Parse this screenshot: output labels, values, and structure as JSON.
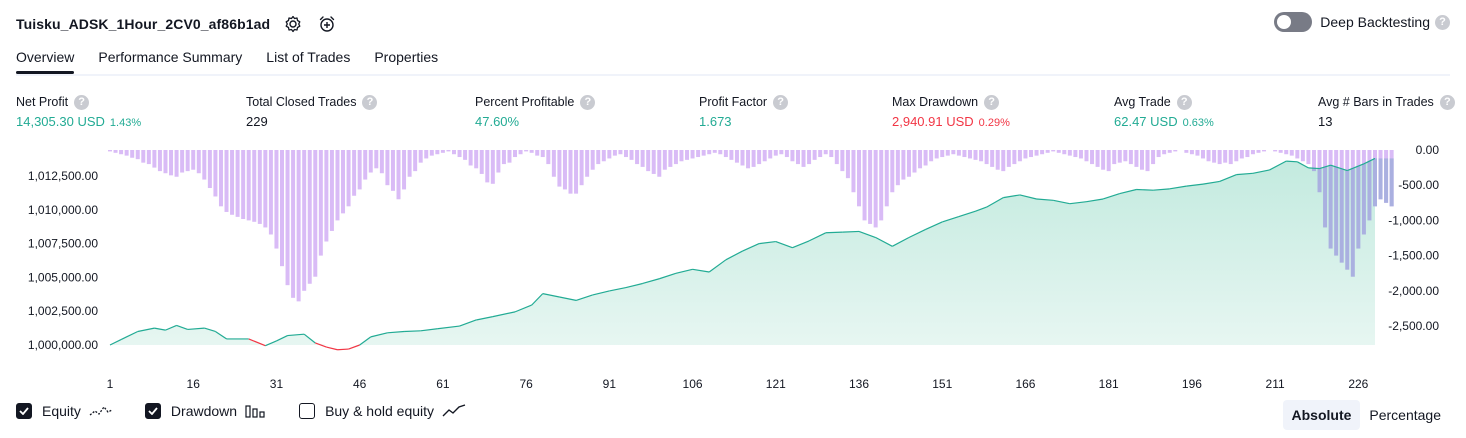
{
  "header": {
    "title": "Tuisku_ADSK_1Hour_2CV0_af86b1ad",
    "deep_backtesting": "Deep Backtesting",
    "help": "?"
  },
  "tabs": [
    "Overview",
    "Performance Summary",
    "List of Trades",
    "Properties"
  ],
  "metrics": [
    {
      "label": "Net Profit",
      "value": "14,305.30 USD",
      "pct": "1.43%",
      "color": "#22ab94"
    },
    {
      "label": "Total Closed Trades",
      "value": "229",
      "pct": "",
      "color": "#131722"
    },
    {
      "label": "Percent Profitable",
      "value": "47.60%",
      "pct": "",
      "color": "#22ab94"
    },
    {
      "label": "Profit Factor",
      "value": "1.673",
      "pct": "",
      "color": "#22ab94"
    },
    {
      "label": "Max Drawdown",
      "value": "2,940.91 USD",
      "pct": "0.29%",
      "color": "#f23645"
    },
    {
      "label": "Avg Trade",
      "value": "62.47 USD",
      "pct": "0.63%",
      "color": "#22ab94"
    },
    {
      "label": "Avg # Bars in Trades",
      "value": "13",
      "pct": "",
      "color": "#131722"
    }
  ],
  "legend": {
    "equity": "Equity",
    "drawdown": "Drawdown",
    "buyhold": "Buy & hold equity"
  },
  "modes": {
    "absolute": "Absolute",
    "percentage": "Percentage"
  },
  "colors": {
    "equity_line": "#22ab94",
    "equity_fill": "#cdeee5",
    "drawdown_bar": "#d9bbf6",
    "drawdown_overlap": "#aab0e0",
    "negative": "#f23645"
  },
  "chart_data": {
    "type": "area",
    "x": [
      1,
      229
    ],
    "xticks": [
      1,
      16,
      31,
      46,
      61,
      76,
      91,
      106,
      121,
      136,
      151,
      166,
      181,
      196,
      211,
      226
    ],
    "left_ticks": [
      "1,012,500.00",
      "1,010,000.00",
      "1,007,500.00",
      "1,005,000.00",
      "1,002,500.00",
      "1,000,000.00"
    ],
    "left_tick_values": [
      1012500,
      1010000,
      1007500,
      1005000,
      1002500,
      1000000
    ],
    "right_ticks": [
      "0.00",
      "-500.00",
      "-1,000.00",
      "-1,500.00",
      "-2,000.00",
      "-2,500.00"
    ],
    "right_tick_values": [
      0,
      -500,
      -1000,
      -1500,
      -2000,
      -2500
    ],
    "equity_ylim": [
      999000,
      1014000
    ],
    "drawdown_ylim": [
      -3000,
      0
    ],
    "series": [
      {
        "name": "Equity",
        "points": [
          [
            1,
            1000000
          ],
          [
            3,
            1000400
          ],
          [
            6,
            1001000
          ],
          [
            9,
            1001250
          ],
          [
            11,
            1001100
          ],
          [
            13,
            1001450
          ],
          [
            15,
            1001150
          ],
          [
            18,
            1001250
          ],
          [
            20,
            1001000
          ],
          [
            22,
            1000450
          ],
          [
            26,
            1000450
          ],
          [
            29,
            999950
          ],
          [
            31,
            1000300
          ],
          [
            33,
            1000700
          ],
          [
            36,
            1000800
          ],
          [
            38,
            1000150
          ],
          [
            40,
            999850
          ],
          [
            42,
            999650
          ],
          [
            44,
            999700
          ],
          [
            46,
            1000000
          ],
          [
            48,
            1000600
          ],
          [
            51,
            1000900
          ],
          [
            54,
            1001000
          ],
          [
            57,
            1001050
          ],
          [
            60,
            1001200
          ],
          [
            64,
            1001400
          ],
          [
            67,
            1001850
          ],
          [
            70,
            1002100
          ],
          [
            74,
            1002450
          ],
          [
            77,
            1002950
          ],
          [
            79,
            1003800
          ],
          [
            82,
            1003550
          ],
          [
            85,
            1003300
          ],
          [
            88,
            1003700
          ],
          [
            91,
            1004000
          ],
          [
            94,
            1004250
          ],
          [
            97,
            1004550
          ],
          [
            100,
            1004900
          ],
          [
            103,
            1005300
          ],
          [
            106,
            1005600
          ],
          [
            109,
            1005400
          ],
          [
            112,
            1006300
          ],
          [
            115,
            1006950
          ],
          [
            118,
            1007500
          ],
          [
            121,
            1007650
          ],
          [
            124,
            1007200
          ],
          [
            127,
            1007700
          ],
          [
            130,
            1008300
          ],
          [
            133,
            1008350
          ],
          [
            136,
            1008400
          ],
          [
            139,
            1007950
          ],
          [
            142,
            1007300
          ],
          [
            145,
            1007950
          ],
          [
            148,
            1008550
          ],
          [
            151,
            1009100
          ],
          [
            154,
            1009500
          ],
          [
            157,
            1009900
          ],
          [
            159,
            1010200
          ],
          [
            162,
            1010900
          ],
          [
            165,
            1011100
          ],
          [
            168,
            1010800
          ],
          [
            171,
            1010700
          ],
          [
            174,
            1010450
          ],
          [
            177,
            1010600
          ],
          [
            180,
            1010800
          ],
          [
            183,
            1011200
          ],
          [
            186,
            1011500
          ],
          [
            189,
            1011450
          ],
          [
            192,
            1011550
          ],
          [
            195,
            1011750
          ],
          [
            198,
            1011900
          ],
          [
            201,
            1012100
          ],
          [
            204,
            1012600
          ],
          [
            207,
            1012700
          ],
          [
            210,
            1012950
          ],
          [
            213,
            1013600
          ],
          [
            215,
            1013550
          ],
          [
            217,
            1013100
          ],
          [
            219,
            1013050
          ],
          [
            221,
            1013300
          ],
          [
            224,
            1012900
          ],
          [
            227,
            1013400
          ],
          [
            229,
            1013800
          ]
        ]
      },
      {
        "name": "Drawdown",
        "values": [
          -20,
          -40,
          -60,
          -80,
          -110,
          -130,
          -180,
          -200,
          -250,
          -300,
          -330,
          -360,
          -380,
          -320,
          -300,
          -280,
          -330,
          -420,
          -540,
          -660,
          -800,
          -880,
          -920,
          -950,
          -980,
          -1000,
          -1020,
          -1050,
          -1100,
          -1200,
          -1400,
          -1650,
          -1920,
          -2100,
          -2150,
          -2000,
          -1900,
          -1800,
          -1500,
          -1300,
          -1150,
          -1000,
          -900,
          -800,
          -650,
          -560,
          -420,
          -320,
          -260,
          -330,
          -500,
          -580,
          -700,
          -560,
          -380,
          -300,
          -180,
          -120,
          -80,
          -60,
          -40,
          -20,
          -60,
          -100,
          -140,
          -220,
          -260,
          -340,
          -460,
          -480,
          -320,
          -200,
          -180,
          -100,
          -60,
          -20,
          -40,
          -80,
          -100,
          -200,
          -380,
          -520,
          -560,
          -620,
          -620,
          -500,
          -380,
          -280,
          -200,
          -160,
          -120,
          -80,
          -60,
          -100,
          -140,
          -200,
          -240,
          -300,
          -340,
          -380,
          -280,
          -240,
          -200,
          -160,
          -140,
          -120,
          -100,
          -80,
          -60,
          -40,
          -60,
          -100,
          -140,
          -180,
          -220,
          -260,
          -240,
          -200,
          -160,
          -120,
          -80,
          -60,
          -100,
          -160,
          -200,
          -240,
          -200,
          -140,
          -100,
          -60,
          -100,
          -200,
          -300,
          -400,
          -600,
          -800,
          -1000,
          -1050,
          -1100,
          -1000,
          -800,
          -600,
          -500,
          -420,
          -380,
          -320,
          -260,
          -220,
          -160,
          -120,
          -100,
          -80,
          -60,
          -80,
          -100,
          -120,
          -140,
          -160,
          -200,
          -240,
          -280,
          -300,
          -240,
          -200,
          -160,
          -120,
          -100,
          -80,
          -60,
          -40,
          -20,
          -40,
          -60,
          -80,
          -100,
          -120,
          -160,
          -200,
          -240,
          -280,
          -300,
          -200,
          -180,
          -160,
          -200,
          -240,
          -280,
          -300,
          -200,
          -100,
          -60,
          -40,
          -20,
          0,
          -40,
          -60,
          -80,
          -120,
          -160,
          -180,
          -200,
          -180,
          -200,
          -160,
          -120,
          -100,
          -60,
          -40,
          -20,
          0,
          -20,
          -40,
          -60,
          -80,
          -120,
          -160,
          -200,
          -300,
          -600,
          -1100,
          -1400,
          -1500,
          -1600,
          -1700,
          -1800,
          -1400,
          -1200,
          -1000,
          -800,
          -700,
          -750,
          -800
        ]
      }
    ]
  }
}
